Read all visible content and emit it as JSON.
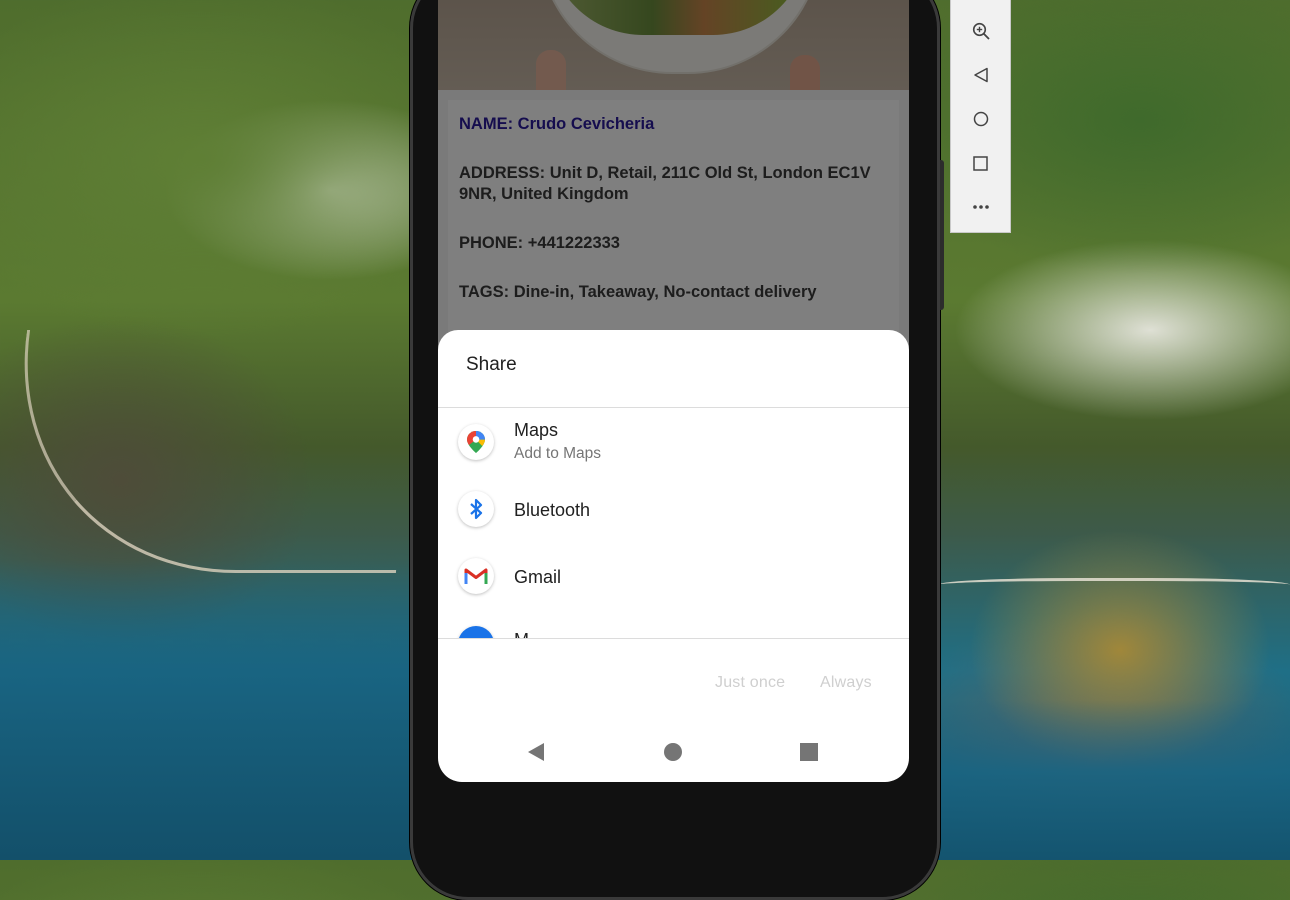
{
  "restaurant": {
    "name": "NAME: Crudo Cevicheria",
    "address": "ADDRESS: Unit D, Retail, 211C Old St, London EC1V 9NR, United Kingdom",
    "phone": "PHONE: +441222333",
    "tags": "TAGS: Dine-in, Takeaway, No-contact delivery"
  },
  "share_sheet": {
    "title": "Share",
    "apps": [
      {
        "label": "Maps",
        "subtitle": "Add to Maps",
        "icon": "google-maps-icon"
      },
      {
        "label": "Bluetooth",
        "subtitle": "",
        "icon": "bluetooth-icon"
      },
      {
        "label": "Gmail",
        "subtitle": "",
        "icon": "gmail-icon"
      },
      {
        "label": "M",
        "subtitle": "",
        "icon": "messages-icon"
      }
    ],
    "just_once_label": "Just once",
    "always_label": "Always"
  },
  "android_nav": {
    "back_icon": "back-triangle-icon",
    "home_icon": "home-circle-icon",
    "recents_icon": "recents-square-icon"
  },
  "emulator_toolbar": {
    "buttons": [
      "zoom-in-icon",
      "back-icon",
      "home-icon",
      "overview-icon",
      "more-icon"
    ]
  },
  "colors": {
    "name_accent": "#2a1a9c",
    "disabled_text": "#cfcfcf",
    "bluetooth_blue": "#1a73e8",
    "gmail_red": "#d93025"
  }
}
